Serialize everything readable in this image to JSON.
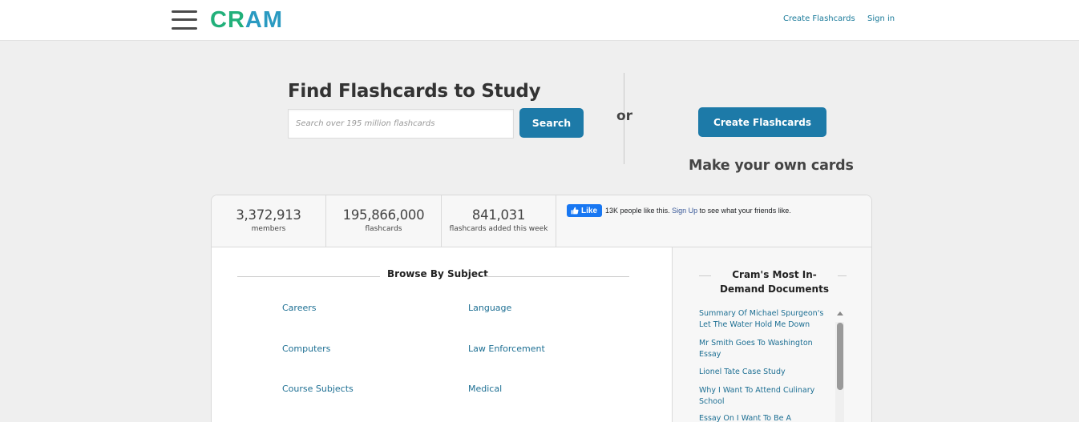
{
  "header": {
    "logo_part1": "CR",
    "logo_part2": "AM",
    "create_link": "Create Flashcards",
    "signin_link": "Sign in"
  },
  "hero": {
    "title": "Find Flashcards to Study",
    "search_placeholder": "Search over 195 million flashcards",
    "search_button": "Search",
    "or_text": "or",
    "create_button": "Create Flashcards",
    "make_own": "Make your own cards"
  },
  "stats": [
    {
      "value": "3,372,913",
      "label": "members"
    },
    {
      "value": "195,866,000",
      "label": "flashcards"
    },
    {
      "value": "841,031",
      "label": "flashcards added this week"
    }
  ],
  "facebook": {
    "like_label": "Like",
    "count_text": "13K people like this.",
    "signup_link": "Sign Up",
    "rest_text": "to see what your friends like."
  },
  "browse": {
    "title": "Browse By Subject",
    "subjects": [
      "Careers",
      "Language",
      "Computers",
      "Law Enforcement",
      "Course Subjects",
      "Medical"
    ]
  },
  "sidebar": {
    "title": "Cram's Most In-Demand Documents",
    "documents": [
      "Summary Of Michael Spurgeon's Let The Water Hold Me Down",
      "Mr Smith Goes To Washington Essay",
      "Lionel Tate Case Study",
      "Why I Want To Attend Culinary School",
      "Essay On I Want To Be A"
    ]
  },
  "colors": {
    "accent_blue": "#1d7aa8",
    "link_blue": "#1d6f93",
    "logo_green": "#21b07a",
    "logo_blue": "#2a9ac1",
    "facebook_blue": "#1877f2"
  },
  "icons": {
    "menu": "hamburger-icon",
    "facebook_like": "thumbs-up-icon",
    "scroll_up": "triangle-up-icon"
  }
}
